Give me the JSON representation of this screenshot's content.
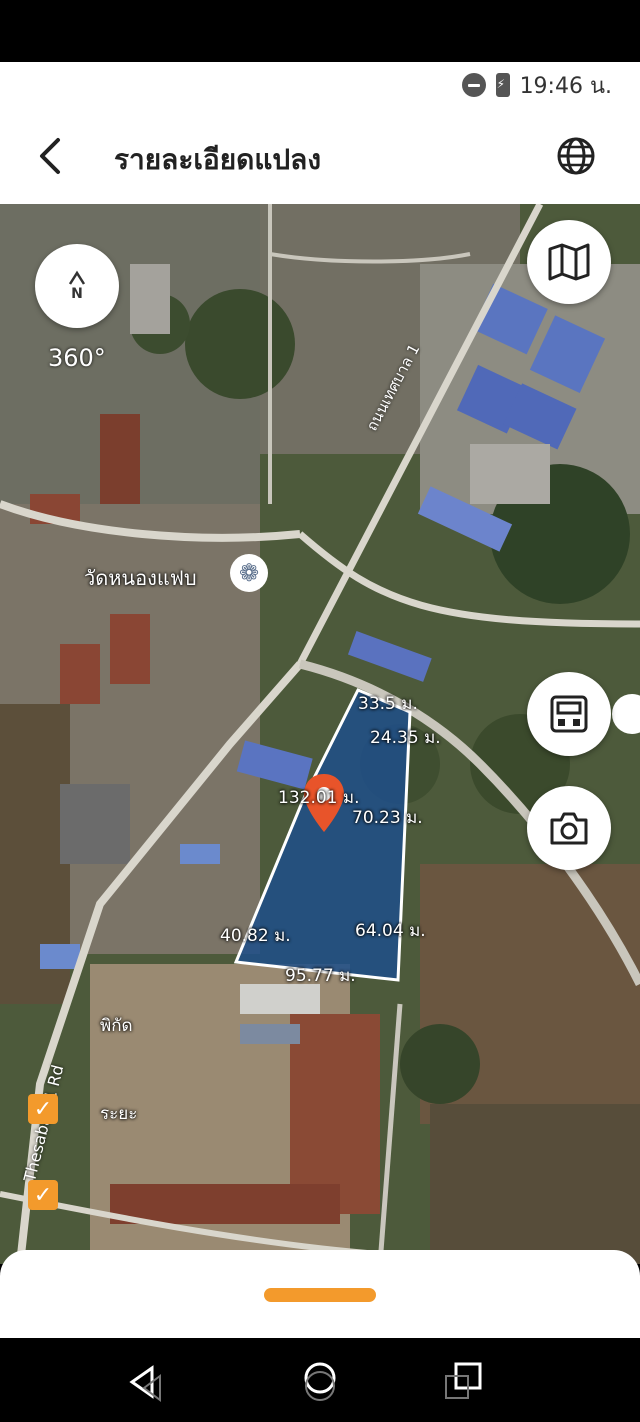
{
  "status": {
    "time": "19:46 น."
  },
  "header": {
    "title": "รายละเอียดแปลง",
    "back_icon": "chevron-left-icon",
    "globe_icon": "globe-icon"
  },
  "map": {
    "compass_label": "N",
    "rotation_label": "360°",
    "place_label": "วัดหนองแฟบ",
    "road_label_1": "ถนนเทศบาล 1",
    "road_label_2": "Thesaban 1 Rd",
    "partial_labels": [
      "พิกัด",
      "ระยะ"
    ],
    "parcel": {
      "measurements": [
        "33.5 ม.",
        "24.35 ม.",
        "70.23 ม.",
        "64.04 ม.",
        "40.82 ม.",
        "95.77 ม.",
        "132.01 ม."
      ],
      "fill_color": "#1f4f8a",
      "outline_color": "#ffffff"
    },
    "pin_color": "#e8542a"
  },
  "buttons": {
    "map_layers": "map-icon",
    "box_view": "box-icon",
    "camera": "camera-icon"
  },
  "sheet": {
    "handle_color": "#f39a2c"
  },
  "navigation": {
    "back": "back-icon",
    "home": "home-icon",
    "recents": "recents-icon"
  }
}
